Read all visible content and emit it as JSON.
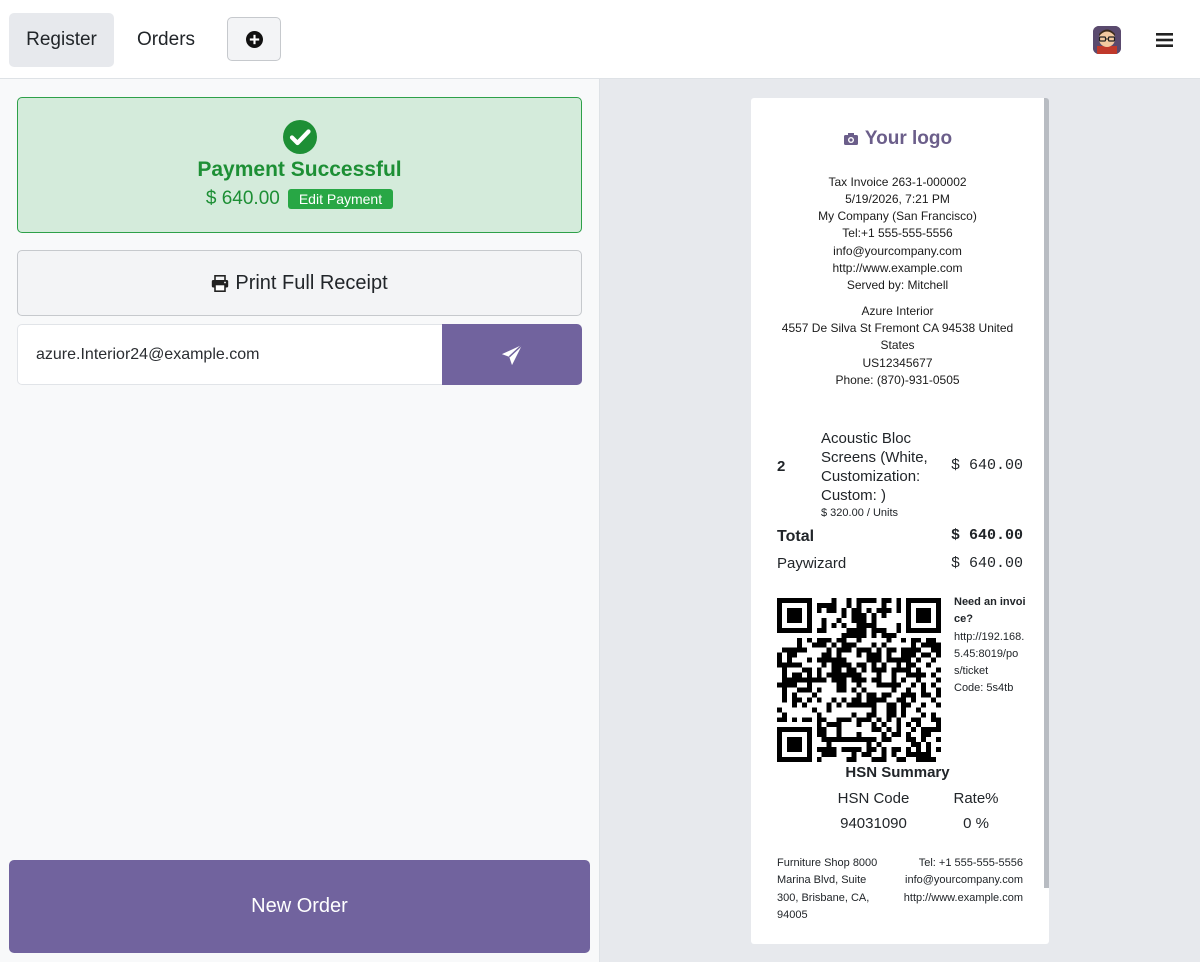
{
  "topbar": {
    "tabs": [
      {
        "label": "Register",
        "active": true
      },
      {
        "label": "Orders",
        "active": false
      }
    ],
    "add_icon": "plus-circle-icon",
    "menu_icon": "hamburger-icon"
  },
  "payment": {
    "status_icon": "check-circle-icon",
    "title": "Payment Successful",
    "amount": "$ 640.00",
    "edit_label": "Edit Payment"
  },
  "actions": {
    "print_icon": "printer-icon",
    "print_label": "Print Full Receipt",
    "email_value": "azure.Interior24@example.com",
    "send_icon": "paper-plane-icon",
    "new_order_label": "New Order"
  },
  "receipt": {
    "logo_icon": "camera-icon",
    "logo_text": "Your logo",
    "header_lines": [
      "Tax Invoice 263-1-000002",
      "5/19/2026, 7:21 PM",
      "My Company (San Francisco)",
      "Tel:+1 555-555-5556",
      "info@yourcompany.com",
      "http://www.example.com",
      "Served by: Mitchell"
    ],
    "customer_lines": [
      "Azure Interior",
      "4557 De Silva St Fremont CA 94538 United States",
      "US12345677",
      "Phone: (870)-931-0505"
    ],
    "line_item": {
      "qty": "2",
      "name": "Acoustic Bloc Screens (White, Customization: Custom: )",
      "unit_price": "$ 320.00 / Units",
      "price": "$ 640.00"
    },
    "total_label": "Total",
    "total_value": "$ 640.00",
    "payment_method": "Paywizard",
    "payment_value": "$ 640.00",
    "invoice_title": "Need an invoice?",
    "invoice_url": "http://192.168.5.45:8019/pos/ticket",
    "invoice_code": "Code: 5s4tb",
    "hsn_title": "HSN Summary",
    "hsn_headers": [
      "HSN Code",
      "Rate%"
    ],
    "hsn_row": [
      "94031090",
      "0 %"
    ],
    "footer_left": "Furniture Shop 8000 Marina Blvd, Suite 300, Brisbane, CA, 94005",
    "footer_right": [
      "Tel: +1 555-555-5556",
      "info@yourcompany.com",
      "http://www.example.com"
    ]
  },
  "colors": {
    "accent": "#71639e",
    "success_bg": "#d4ebdb",
    "success_text": "#1d8f35",
    "edit_badge": "#28a745"
  }
}
